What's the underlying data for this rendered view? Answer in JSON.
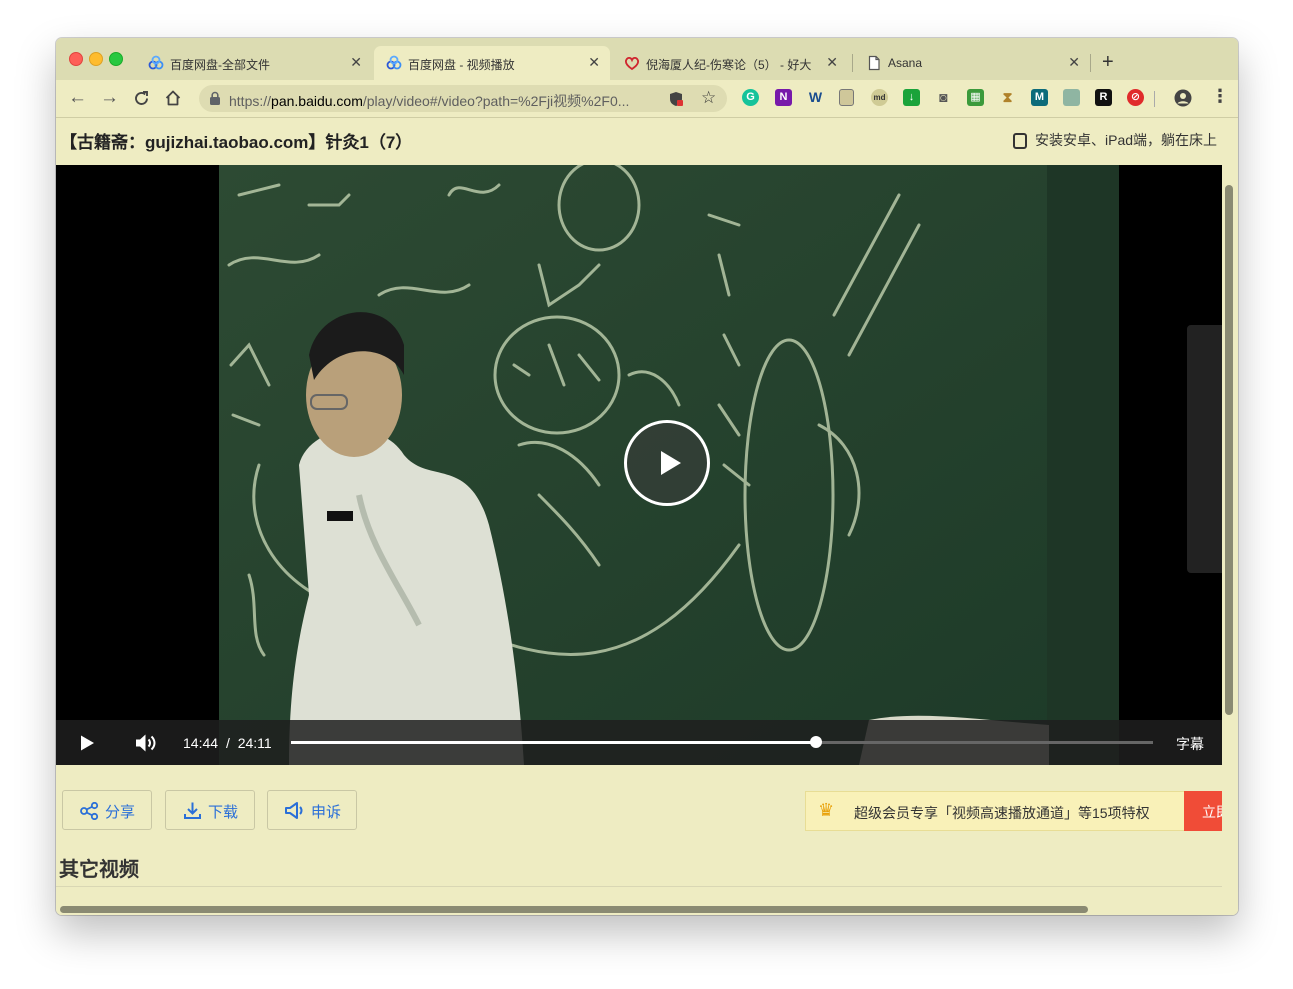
{
  "browser": {
    "tabs": [
      {
        "title": "百度网盘-全部文件",
        "icon": "baidu-netdisk-icon",
        "active": false
      },
      {
        "title": "百度网盘 - 视频播放",
        "icon": "baidu-netdisk-icon",
        "active": true
      },
      {
        "title": "倪海厦人纪-伤寒论（5） - 好大",
        "icon": "heart-logo-icon",
        "active": false
      },
      {
        "title": "Asana",
        "icon": "document-icon",
        "active": false
      }
    ],
    "new_tab_label": "+",
    "url": {
      "scheme": "https://",
      "host": "pan.baidu.com",
      "path": "/play/video#/video?path=%2Fji视频%2F0..."
    },
    "extensions": [
      "grammarly-icon",
      "onenote-icon",
      "word-icon",
      "note-icon",
      "md-icon",
      "download-icon",
      "camera-icon",
      "sheet-icon",
      "hourglass-icon",
      "m-icon",
      "book-icon",
      "r-icon",
      "block-icon"
    ]
  },
  "page": {
    "title": "【古籍斋：gujizhai.taobao.com】针灸1（7）",
    "install_text": "安装安卓、iPad端，躺在床上"
  },
  "player": {
    "current_time": "14:44",
    "separator": "/",
    "duration": "24:11",
    "progress_fraction": 0.6095,
    "subtitle_label": "字幕"
  },
  "actions": {
    "share": "分享",
    "download": "下载",
    "report": "申诉"
  },
  "promo": {
    "text": "超级会员专享「视频高速播放通道」等15项特权",
    "cta": "立即开通"
  },
  "other_videos": {
    "title": "其它视频"
  },
  "colors": {
    "page_bg": "#eeecc2",
    "accent_blue": "#2a6fd8",
    "cta_red": "#f04c37",
    "chalkboard": "#23422d"
  }
}
